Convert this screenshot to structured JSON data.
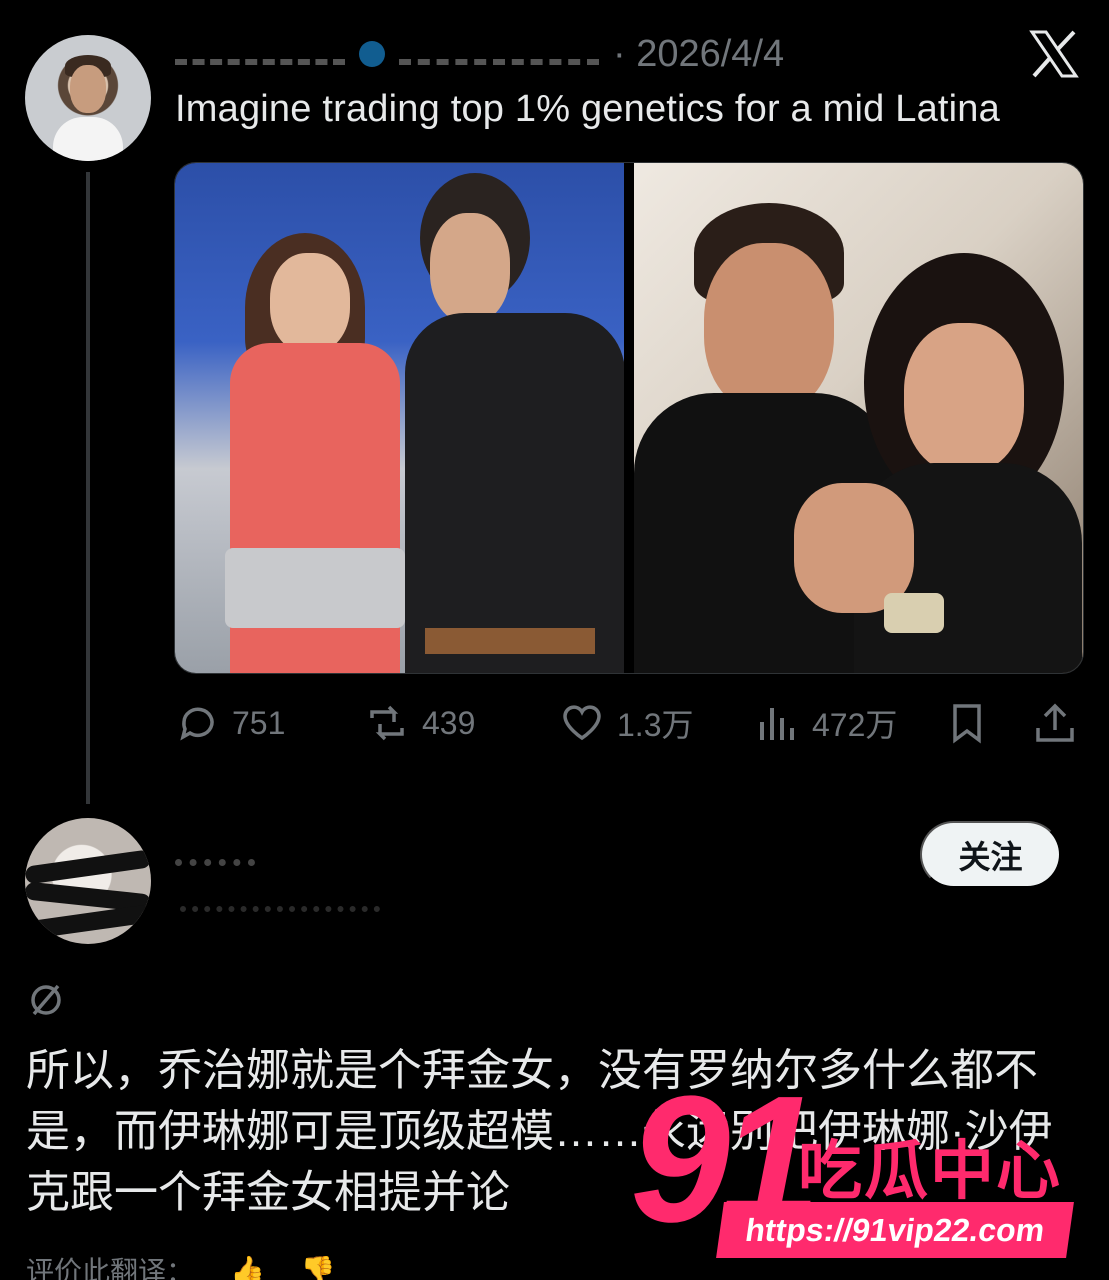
{
  "tweet": {
    "date": "· 2026/4/4",
    "text": "Imagine trading top 1% genetics for a mid Latina",
    "stats": {
      "replies": "751",
      "reposts": "439",
      "likes": "1.3万",
      "views": "472万"
    }
  },
  "reply": {
    "follow_label": "关注",
    "text": "所以，乔治娜就是个拜金女，没有罗纳尔多什么都不是，而伊琳娜可是顶级超模……永远别把伊琳娜·沙伊克跟一个拜金女相提并论",
    "rate_label": "评价此翻译："
  },
  "watermark": {
    "number": "91",
    "title": "吃瓜中心",
    "url": "https://91vip22.com"
  },
  "colors": {
    "background": "#000000",
    "text": "#e7e9ea",
    "muted": "#71767b",
    "watermark": "#ff2a6d"
  }
}
